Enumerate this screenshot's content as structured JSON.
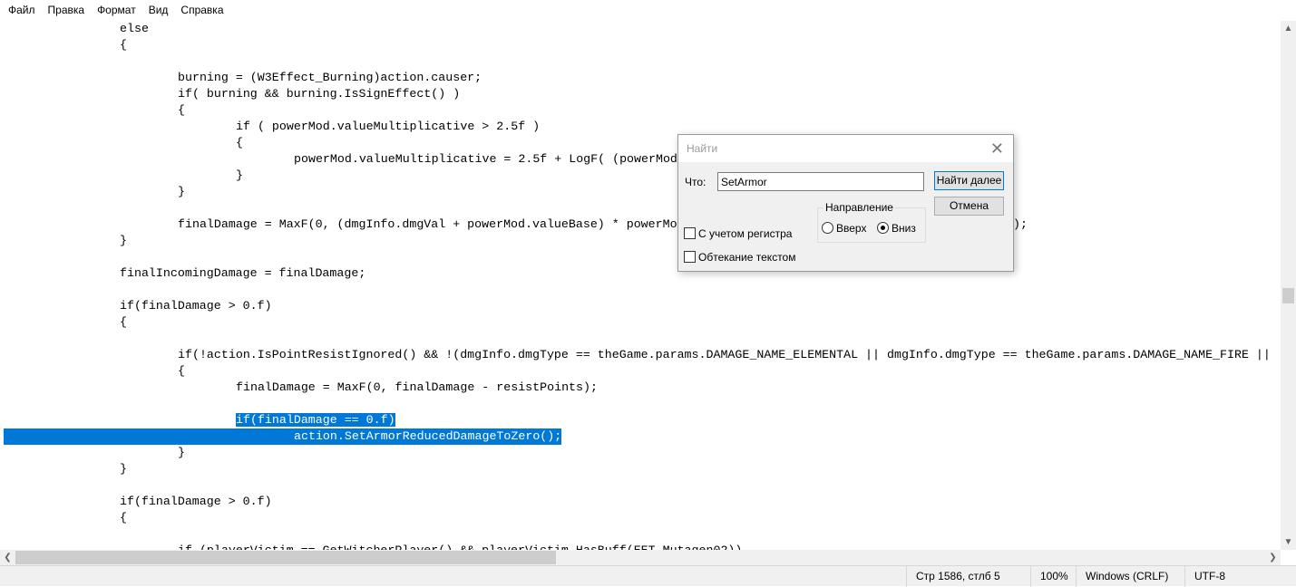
{
  "menu": [
    "Файл",
    "Правка",
    "Формат",
    "Вид",
    "Справка"
  ],
  "code": [
    {
      "i": 2,
      "t": "else"
    },
    {
      "i": 2,
      "t": "{"
    },
    {
      "i": 0,
      "t": ""
    },
    {
      "i": 3,
      "t": "burning = (W3Effect_Burning)action.causer;"
    },
    {
      "i": 3,
      "t": "if( burning && burning.IsSignEffect() )"
    },
    {
      "i": 3,
      "t": "{"
    },
    {
      "i": 4,
      "t": "if ( powerMod.valueMultiplicative > 2.5f )"
    },
    {
      "i": 4,
      "t": "{"
    },
    {
      "i": 5,
      "t": "powerMod.valueMultiplicative = 2.5f + LogF( (powerMod"
    },
    {
      "i": 4,
      "t": "}"
    },
    {
      "i": 3,
      "t": "}"
    },
    {
      "i": 0,
      "t": ""
    },
    {
      "i": 3,
      "t": "finalDamage = MaxF(0, (dmgInfo.dmgVal + powerMod.valueBase) * powerMo",
      "tail": ");"
    },
    {
      "i": 2,
      "t": "}"
    },
    {
      "i": 0,
      "t": ""
    },
    {
      "i": 2,
      "t": "finalIncomingDamage = finalDamage;"
    },
    {
      "i": 0,
      "t": ""
    },
    {
      "i": 2,
      "t": "if(finalDamage > 0.f)"
    },
    {
      "i": 2,
      "t": "{"
    },
    {
      "i": 0,
      "t": ""
    },
    {
      "i": 3,
      "t": "if(!action.IsPointResistIgnored() && !(dmgInfo.dmgType == theGame.params.DAMAGE_NAME_ELEMENTAL || dmgInfo.dmgType == theGame.params.DAMAGE_NAME_FIRE ||"
    },
    {
      "i": 3,
      "t": "{"
    },
    {
      "i": 4,
      "t": "finalDamage = MaxF(0, finalDamage - resistPoints);"
    },
    {
      "i": 0,
      "t": ""
    },
    {
      "i": 4,
      "t": "if(finalDamage == 0.f)",
      "sel": "part"
    },
    {
      "i": 5,
      "t": "action.SetArmorReducedDamageToZero();",
      "sel": "full"
    },
    {
      "i": 3,
      "t": "}"
    },
    {
      "i": 2,
      "t": "}"
    },
    {
      "i": 0,
      "t": ""
    },
    {
      "i": 2,
      "t": "if(finalDamage > 0.f)"
    },
    {
      "i": 2,
      "t": "{"
    },
    {
      "i": 0,
      "t": ""
    },
    {
      "i": 3,
      "t": "if (playerVictim == GetWitcherPlayer() && playerVictim.HasBuff(EET_Mutagen02))"
    }
  ],
  "dialog": {
    "title": "Найти",
    "what_label": "Что:",
    "search_value": "SetArmor",
    "find_next": "Найти далее",
    "cancel": "Отмена",
    "direction_label": "Направление",
    "up": "Вверх",
    "down": "Вниз",
    "match_case": "С учетом регистра",
    "wrap": "Обтекание текстом",
    "direction_selected": "down"
  },
  "status": {
    "position": "Стр 1586, стлб 5",
    "zoom": "100%",
    "line_ending": "Windows (CRLF)",
    "encoding": "UTF-8"
  },
  "colors": {
    "selection": "#0078d7"
  }
}
